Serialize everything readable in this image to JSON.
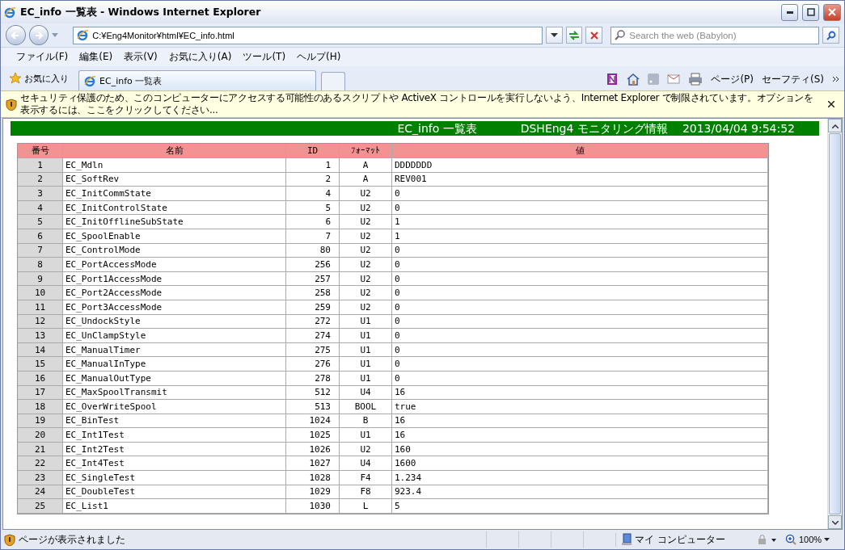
{
  "window": {
    "title": "EC_info 一覧表 - Windows Internet Explorer"
  },
  "address_bar": {
    "value": "C:¥Eng4Monitor¥html¥EC_info.html"
  },
  "search": {
    "placeholder": "Search the web (Babylon)"
  },
  "menu": [
    "ファイル(F)",
    "編集(E)",
    "表示(V)",
    "お気に入り(A)",
    "ツール(T)",
    "ヘルプ(H)"
  ],
  "favorites": {
    "label": "お気に入り"
  },
  "tabs": [
    {
      "label": "EC_info 一覧表",
      "selected": true
    }
  ],
  "command_bar": [
    "ページ(P)",
    "セーフティ(S)"
  ],
  "info_bar": {
    "text": "セキュリティ保護のため、このコンピューターにアクセスする可能性のあるスクリプトや ActiveX コントロールを実行しないよう、Internet Explorer で制限されています。オプションを表示するには、ここをクリックしてください..."
  },
  "page": {
    "header": [
      "EC_info 一覧表",
      "DSHEng4 モニタリング情報",
      "2013/04/04 9:54:52"
    ],
    "table": {
      "columns": [
        "番号",
        "名前",
        "ID",
        "ﾌｫｰﾏｯﾄ",
        "値"
      ],
      "rows": [
        [
          "1",
          "EC_Mdln",
          "1",
          "A",
          "DDDDDDD"
        ],
        [
          "2",
          "EC_SoftRev",
          "2",
          "A",
          "REV001"
        ],
        [
          "3",
          "EC_InitCommState",
          "4",
          "U2",
          "0"
        ],
        [
          "4",
          "EC_InitControlState",
          "5",
          "U2",
          "0"
        ],
        [
          "5",
          "EC_InitOfflineSubState",
          "6",
          "U2",
          "1"
        ],
        [
          "6",
          "EC_SpoolEnable",
          "7",
          "U2",
          "1"
        ],
        [
          "7",
          "EC_ControlMode",
          "80",
          "U2",
          "0"
        ],
        [
          "8",
          "EC_PortAccessMode",
          "256",
          "U2",
          "0"
        ],
        [
          "9",
          "EC_Port1AccessMode",
          "257",
          "U2",
          "0"
        ],
        [
          "10",
          "EC_Port2AccessMode",
          "258",
          "U2",
          "0"
        ],
        [
          "11",
          "EC_Port3AccessMode",
          "259",
          "U2",
          "0"
        ],
        [
          "12",
          "EC_UndockStyle",
          "272",
          "U1",
          "0"
        ],
        [
          "13",
          "EC_UnClampStyle",
          "274",
          "U1",
          "0"
        ],
        [
          "14",
          "EC_ManualTimer",
          "275",
          "U1",
          "0"
        ],
        [
          "15",
          "EC_ManualInType",
          "276",
          "U1",
          "0"
        ],
        [
          "16",
          "EC_ManualOutType",
          "278",
          "U1",
          "0"
        ],
        [
          "17",
          "EC_MaxSpoolTransmit",
          "512",
          "U4",
          "16"
        ],
        [
          "18",
          "EC_OverWriteSpool",
          "513",
          "BOOL",
          "true"
        ],
        [
          "19",
          "EC_BinTest",
          "1024",
          "B",
          "16"
        ],
        [
          "20",
          "EC_Int1Test",
          "1025",
          "U1",
          "16"
        ],
        [
          "21",
          "EC_Int2Test",
          "1026",
          "U2",
          "160"
        ],
        [
          "22",
          "EC_Int4Test",
          "1027",
          "U4",
          "1600"
        ],
        [
          "23",
          "EC_SingleTest",
          "1028",
          "F4",
          "1.234"
        ],
        [
          "24",
          "EC_DoubleTest",
          "1029",
          "F8",
          "923.4"
        ],
        [
          "25",
          "EC_List1",
          "1030",
          "L",
          "5"
        ]
      ]
    }
  },
  "status_bar": {
    "text": "ページが表示されました",
    "zone": "マイ コンピューター",
    "zoom": "100%"
  }
}
